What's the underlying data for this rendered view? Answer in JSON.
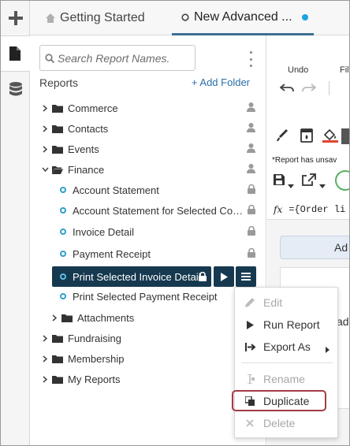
{
  "tabs": [
    {
      "label": "Getting Started",
      "icon": "home-icon"
    },
    {
      "label": "New Advanced ...",
      "icon": "circle-icon",
      "modified": true
    }
  ],
  "sidebar": {
    "search_placeholder": "Search Report Names.",
    "reports_title": "Reports",
    "add_folder_label": "+ Add Folder",
    "tree": [
      {
        "label": "Commerce",
        "type": "folder",
        "expanded": false
      },
      {
        "label": "Contacts",
        "type": "folder",
        "expanded": false
      },
      {
        "label": "Events",
        "type": "folder",
        "expanded": false
      },
      {
        "label": "Finance",
        "type": "folder",
        "expanded": true
      },
      {
        "label": "Account Statement",
        "type": "report"
      },
      {
        "label": "Account Statement for Selected Cont...",
        "type": "report"
      },
      {
        "label": "Invoice Detail",
        "type": "report"
      },
      {
        "label": "Payment Receipt",
        "type": "report"
      },
      {
        "label": "Print Selected Invoice Detail",
        "type": "report",
        "selected": true
      },
      {
        "label": "Print Selected Payment Receipt",
        "type": "report"
      },
      {
        "label": "Attachments",
        "type": "folder",
        "expanded": false
      },
      {
        "label": "Fundraising",
        "type": "folder",
        "expanded": false
      },
      {
        "label": "Membership",
        "type": "folder",
        "expanded": false
      },
      {
        "label": "My Reports",
        "type": "folder",
        "expanded": false
      }
    ]
  },
  "right_pane": {
    "undo_label": "Undo",
    "filter_label_truncated": "Filt",
    "unsaved_note": "*Report has unsav",
    "formula_prefix": "fx",
    "formula_text": "={Order li",
    "add_tab_label": "Ad",
    "card_text": "ad"
  },
  "context_menu": [
    {
      "label": "Edit",
      "icon": "pencil-icon",
      "disabled": true
    },
    {
      "label": "Run Report",
      "icon": "play-icon",
      "disabled": false
    },
    {
      "label": "Export As",
      "icon": "export-icon",
      "disabled": false,
      "submenu": true
    },
    {
      "label": "Rename",
      "icon": "rename-icon",
      "disabled": true
    },
    {
      "label": "Duplicate",
      "icon": "duplicate-icon",
      "disabled": false,
      "highlighted": true
    },
    {
      "label": "Delete",
      "icon": "close-icon",
      "disabled": true
    }
  ],
  "colors": {
    "selection_bg": "#16394f",
    "accent_link": "#2a6ea6",
    "report_dot": "#2e9fcf",
    "highlight_outline": "#a33b46",
    "tab_modified_dot": "#1aa3e0"
  }
}
